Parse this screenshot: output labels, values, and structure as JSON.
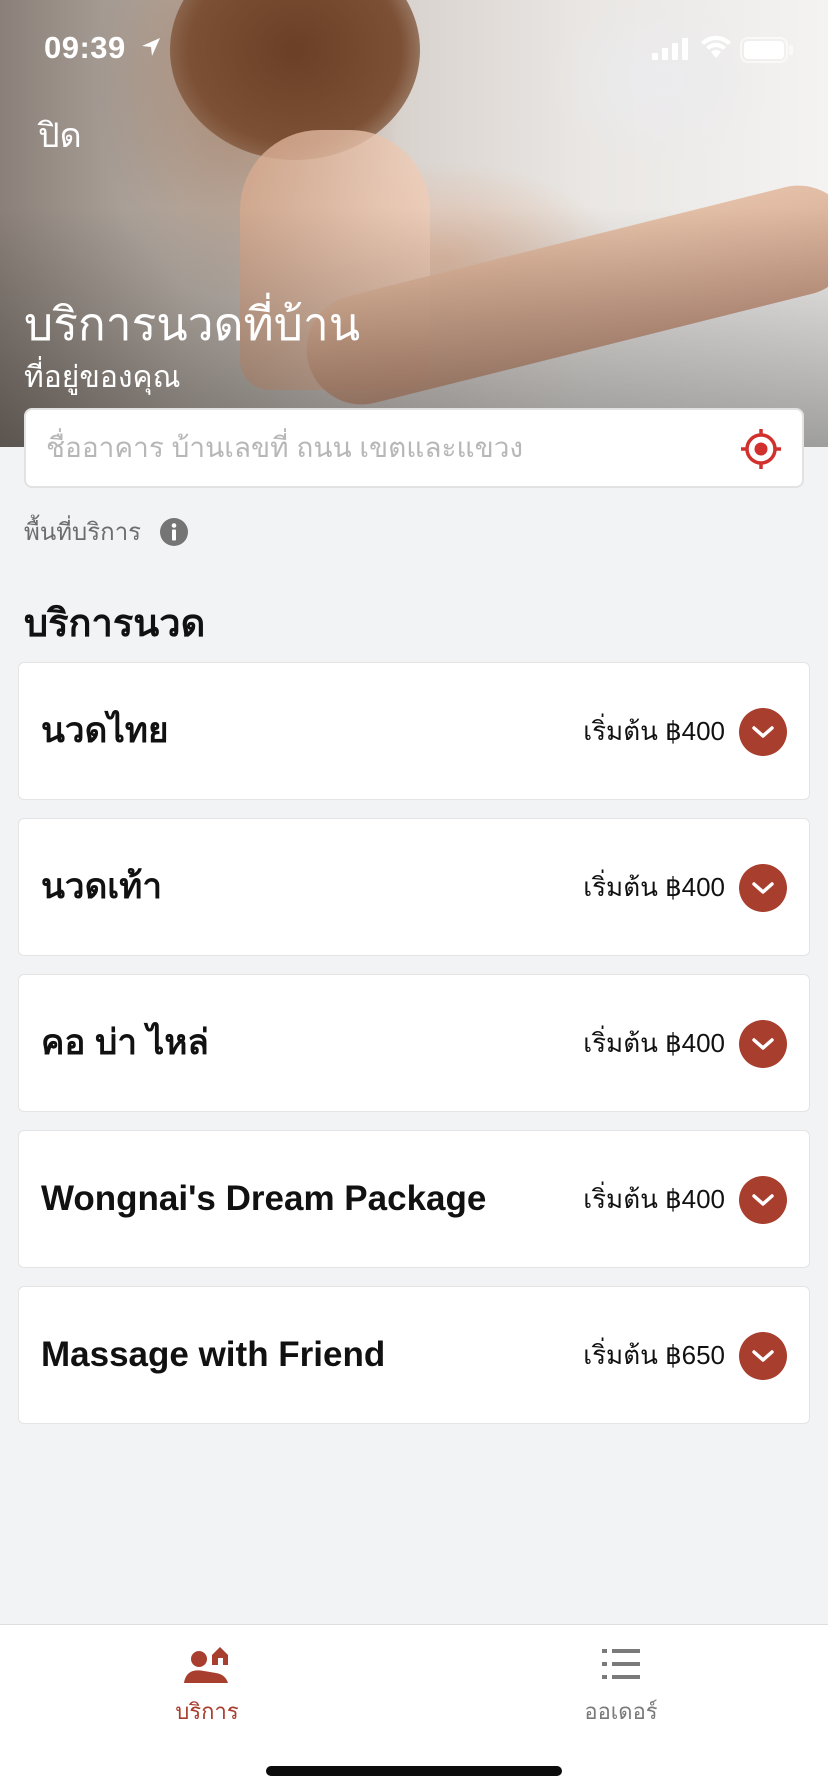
{
  "status_bar": {
    "time": "09:39"
  },
  "header": {
    "close_label": "ปิด",
    "title": "บริการนวดที่บ้าน",
    "subtitle": "ที่อยู่ของคุณ"
  },
  "address": {
    "placeholder": "ชื่ออาคาร บ้านเลขที่ ถนน เขตและแขวง",
    "value": ""
  },
  "service_area": {
    "label": "พื้นที่บริการ"
  },
  "section": {
    "title": "บริการนวด"
  },
  "services": [
    {
      "name": "นวดไทย",
      "price": "เริ่มต้น ฿400"
    },
    {
      "name": "นวดเท้า",
      "price": "เริ่มต้น ฿400"
    },
    {
      "name": "คอ บ่า ไหล่",
      "price": "เริ่มต้น ฿400"
    },
    {
      "name": "Wongnai's Dream Package",
      "price": "เริ่มต้น ฿400"
    },
    {
      "name": "Massage with Friend",
      "price": "เริ่มต้น ฿650"
    }
  ],
  "tab_bar": {
    "tabs": [
      {
        "label": "บริการ",
        "icon": "massage-service-icon",
        "active": true
      },
      {
        "label": "ออเดอร์",
        "icon": "list-icon",
        "active": false
      }
    ]
  },
  "colors": {
    "accent": "#a83e2e",
    "locate_red": "#d0312d",
    "background": "#f2f3f5",
    "inactive_tab": "#7a7a7a"
  }
}
